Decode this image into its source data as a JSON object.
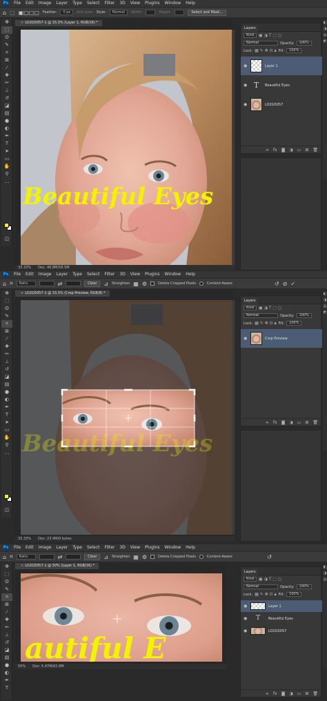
{
  "menu": {
    "ps_logo": "Ps",
    "items": [
      "File",
      "Edit",
      "Image",
      "Layer",
      "Type",
      "Select",
      "Filter",
      "3D",
      "View",
      "Plugins",
      "Window",
      "Help"
    ]
  },
  "screen1": {
    "options": {
      "feather_label": "Feather:",
      "feather_value": "0 px",
      "antialias_label": "Anti-alias",
      "style_label": "Style:",
      "style_value": "Normal",
      "width_label": "Width:",
      "height_label": "Height:",
      "select_mask_button": "Select and Mask..."
    },
    "doc_tab": "LO2G5057-1 @ 33.3% (Layer 1, RGB/16) *",
    "status_zoom": "33.33%",
    "status_doc": "Doc: 46.8M/58.5M",
    "canvas_text": "Beautiful Eyes",
    "layers_panel": {
      "title": "Layers",
      "kind": "Kind",
      "blend": "Normal",
      "opacity_label": "Opacity:",
      "opacity": "100%",
      "lock_label": "Lock:",
      "fill_label": "Fill:",
      "fill": "100%",
      "layers": [
        "Layer 1",
        "Beautiful Eyes",
        "LO2G5057"
      ]
    }
  },
  "screen2": {
    "options": {
      "ratio_value": "Ratio",
      "clear_button": "Clear",
      "straighten_label": "Straighten",
      "delete_cropped_label": "Delete Cropped Pixels",
      "content_aware_label": "Content-Aware"
    },
    "doc_tab": "LO2G5057-1 @ 33.3% (Crop Preview, RGB/8) *",
    "status_zoom": "33.33%",
    "status_doc": "Doc: 23.4M/0 bytes",
    "canvas_text": "Beautiful Eyes",
    "layers_panel": {
      "title": "Layers",
      "kind": "Kind",
      "blend": "Normal",
      "opacity_label": "Opacity:",
      "opacity": "100%",
      "lock_label": "Lock:",
      "fill_label": "Fill:",
      "fill": "100%",
      "layers": [
        "Crop Preview"
      ]
    }
  },
  "screen3": {
    "options": {
      "ratio_value": "Ratio",
      "clear_button": "Clear",
      "straighten_label": "Straighten",
      "delete_cropped_label": "Delete Cropped Pixels",
      "content_aware_label": "Content-Aware"
    },
    "doc_tab": "LO2G5057-1 @ 50% (Layer 1, RGB/16) *",
    "status_zoom": "50%",
    "status_doc": "Doc: 5.47M/62.8M",
    "canvas_text": "autiful E",
    "layers_panel": {
      "title": "Layers",
      "kind": "Kind",
      "blend": "Normal",
      "opacity_label": "Opacity:",
      "opacity": "100%",
      "lock_label": "Lock:",
      "fill_label": "Fill:",
      "fill": "100%",
      "layers": [
        "Layer 1",
        "Beautiful Eyes",
        "LO2G5057"
      ]
    }
  },
  "colors": {
    "headline_yellow": "#f3f300",
    "layer_selected": "#4b5c74",
    "foreground_swatch": "#f3f300"
  },
  "icons": [
    "home-icon",
    "marquee-icon",
    "crop-icon",
    "eye-icon",
    "lock-icon",
    "cancel-icon",
    "commit-check-icon",
    "reset-icon",
    "settings-gear-icon",
    "trash-icon",
    "new-layer-icon"
  ]
}
